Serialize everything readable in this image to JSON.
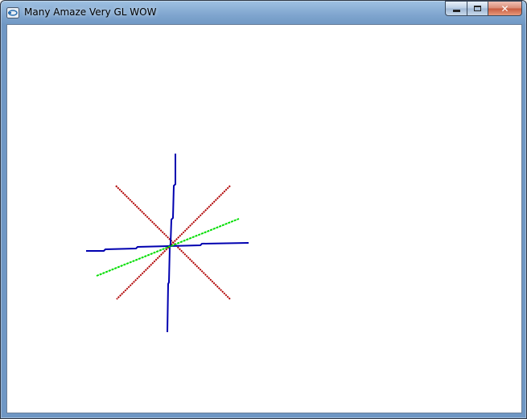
{
  "window": {
    "title": "Many Amaze Very GL WOW",
    "controls": {
      "minimize_icon": "minimize-icon",
      "maximize_icon": "maximize-icon",
      "close_icon": "close-icon",
      "close_glyph": "✕"
    }
  },
  "scene": {
    "background": "#ffffff",
    "colors": {
      "red_axes": "#b00000",
      "blue_axes": "#0000b0",
      "green_line": "#00dd00"
    }
  }
}
